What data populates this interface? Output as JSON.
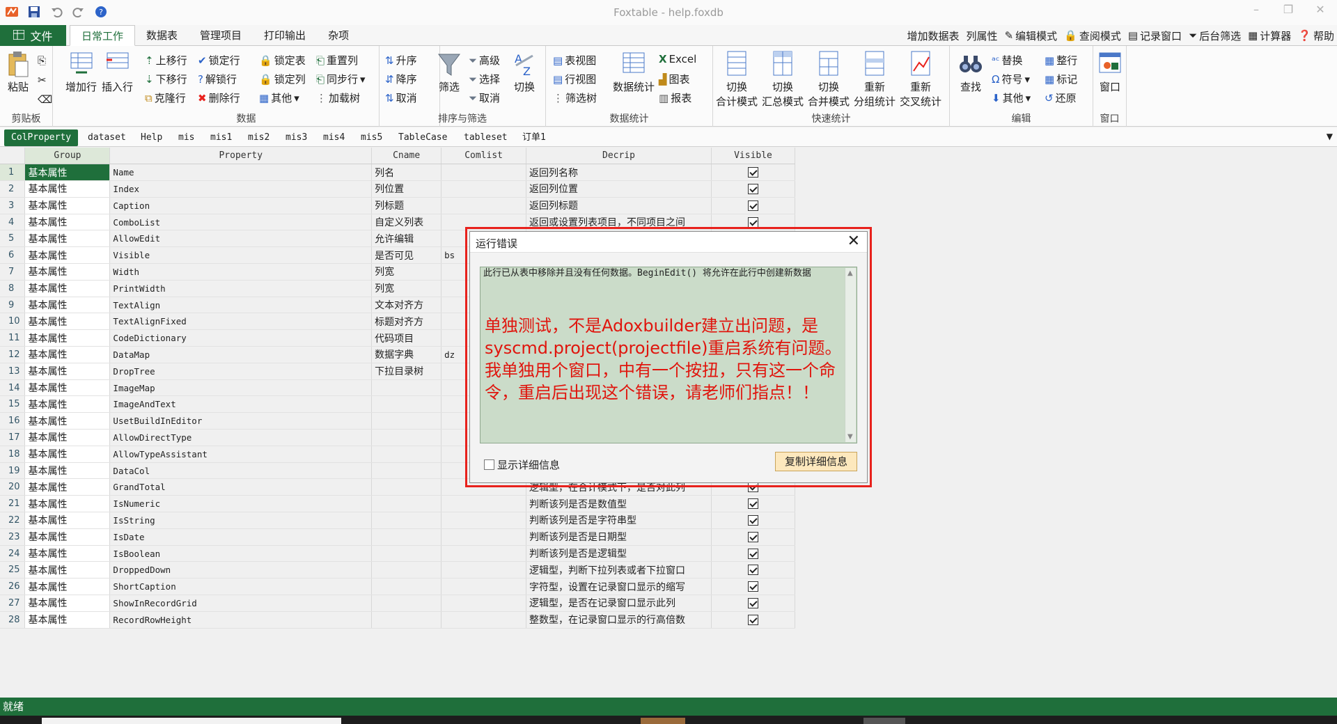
{
  "window": {
    "title": "Foxtable - help.foxdb"
  },
  "tabs": {
    "file": "文件",
    "items": [
      "日常工作",
      "数据表",
      "管理项目",
      "打印输出",
      "杂项"
    ]
  },
  "quick": {
    "add_table": "增加数据表",
    "col_props": "列属性",
    "edit_mode": "编辑模式",
    "view_mode": "查阅模式",
    "record_window": "记录窗口",
    "bg_filter": "后台筛选",
    "calculator": "计算器",
    "help": "帮助"
  },
  "ribbon": {
    "clipboard": {
      "label": "剪贴板",
      "paste": "粘贴"
    },
    "data": {
      "label": "数据",
      "add_row": "增加行",
      "insert_row": "插入行",
      "move_up": "上移行",
      "move_down": "下移行",
      "clone_row": "克隆行",
      "lock_row": "锁定行",
      "unlock_row": "解锁行",
      "delete_row": "删除行",
      "lock_table": "锁定表",
      "lock_col": "锁定列",
      "other": "其他",
      "reset_col": "重置列",
      "sync_row": "同步行",
      "load_tree": "加载树"
    },
    "sort": {
      "label": "排序与筛选",
      "asc": "升序",
      "desc": "降序",
      "cancel": "取消",
      "filter": "筛选",
      "advanced": "高级",
      "select": "选择",
      "cancel2": "取消",
      "switch": "切换"
    },
    "stats": {
      "label": "数据统计",
      "table_view": "表视图",
      "row_view": "行视图",
      "filter_tree": "筛选树",
      "data_stats": "数据统计",
      "excel": "Excel",
      "chart": "图表",
      "report": "报表"
    },
    "quickstats": {
      "label": "快速统计",
      "b1": [
        "切换",
        "合计模式"
      ],
      "b2": [
        "切换",
        "汇总模式"
      ],
      "b3": [
        "切换",
        "合并模式"
      ],
      "b4": [
        "重新",
        "分组统计"
      ],
      "b5": [
        "重新",
        "交叉统计"
      ]
    },
    "edit": {
      "label": "编辑",
      "find": "查找",
      "replace": "替换",
      "symbol": "符号",
      "other": "其他",
      "whole_row": "整行",
      "mark": "标记",
      "restore": "还原"
    },
    "window": {
      "label": "窗口",
      "window": "窗口"
    }
  },
  "sheet_tabs": [
    "ColProperty",
    "dataset",
    "Help",
    "mis",
    "mis1",
    "mis2",
    "mis3",
    "mis4",
    "mis5",
    "TableCase",
    "tableset",
    "订单1"
  ],
  "grid": {
    "columns": [
      "Group",
      "Property",
      "Cname",
      "Comlist",
      "Decrip",
      "Visible"
    ],
    "rows": [
      {
        "n": "1",
        "g": "基本属性",
        "p": "Name",
        "c": "列名",
        "cl": "",
        "d": "返回列名称",
        "v": true
      },
      {
        "n": "2",
        "g": "基本属性",
        "p": "Index",
        "c": "列位置",
        "cl": "",
        "d": "返回列位置",
        "v": true
      },
      {
        "n": "3",
        "g": "基本属性",
        "p": "Caption",
        "c": "列标题",
        "cl": "",
        "d": "返回列标题",
        "v": true
      },
      {
        "n": "4",
        "g": "基本属性",
        "p": "ComboList",
        "c": "自定义列表",
        "cl": "",
        "d": "返回或设置列表项目，不同项目之间",
        "v": true
      },
      {
        "n": "5",
        "g": "基本属性",
        "p": "AllowEdit",
        "c": "允许编辑",
        "cl": "",
        "d": "",
        "v": false
      },
      {
        "n": "6",
        "g": "基本属性",
        "p": "Visible",
        "c": "是否可见",
        "cl": "bs",
        "d": "",
        "v": false
      },
      {
        "n": "7",
        "g": "基本属性",
        "p": "Width",
        "c": "列宽",
        "cl": "",
        "d": "",
        "v": false
      },
      {
        "n": "8",
        "g": "基本属性",
        "p": "PrintWidth",
        "c": "列宽",
        "cl": "",
        "d": "",
        "v": false
      },
      {
        "n": "9",
        "g": "基本属性",
        "p": "TextAlign",
        "c": "文本对齐方",
        "cl": "",
        "d": "",
        "v": false
      },
      {
        "n": "10",
        "g": "基本属性",
        "p": "TextAlignFixed",
        "c": "标题对齐方",
        "cl": "",
        "d": "",
        "v": false
      },
      {
        "n": "11",
        "g": "基本属性",
        "p": "CodeDictionary",
        "c": "代码项目",
        "cl": "",
        "d": "",
        "v": false
      },
      {
        "n": "12",
        "g": "基本属性",
        "p": "DataMap",
        "c": "数据字典",
        "cl": "dz",
        "d": "",
        "v": false
      },
      {
        "n": "13",
        "g": "基本属性",
        "p": "DropTree",
        "c": "下拉目录树",
        "cl": "",
        "d": "",
        "v": false
      },
      {
        "n": "14",
        "g": "基本属性",
        "p": "ImageMap",
        "c": "",
        "cl": "",
        "d": "",
        "v": false
      },
      {
        "n": "15",
        "g": "基本属性",
        "p": "ImageAndText",
        "c": "",
        "cl": "",
        "d": "",
        "v": false
      },
      {
        "n": "16",
        "g": "基本属性",
        "p": "UsetBuildInEditor",
        "c": "",
        "cl": "",
        "d": "",
        "v": false
      },
      {
        "n": "17",
        "g": "基本属性",
        "p": "AllowDirectType",
        "c": "",
        "cl": "",
        "d": "",
        "v": false
      },
      {
        "n": "18",
        "g": "基本属性",
        "p": "AllowTypeAssistant",
        "c": "",
        "cl": "",
        "d": "",
        "v": false
      },
      {
        "n": "19",
        "g": "基本属性",
        "p": "DataCol",
        "c": "",
        "cl": "",
        "d": "",
        "v": false
      },
      {
        "n": "20",
        "g": "基本属性",
        "p": "GrandTotal",
        "c": "",
        "cl": "",
        "d": "逻辑型，在合计模式下，是否对此列",
        "v": true
      },
      {
        "n": "21",
        "g": "基本属性",
        "p": "IsNumeric",
        "c": "",
        "cl": "",
        "d": "判断该列是否是数值型",
        "v": true
      },
      {
        "n": "22",
        "g": "基本属性",
        "p": "IsString",
        "c": "",
        "cl": "",
        "d": "判断该列是否是字符串型",
        "v": true
      },
      {
        "n": "23",
        "g": "基本属性",
        "p": "IsDate",
        "c": "",
        "cl": "",
        "d": "判断该列是否是日期型",
        "v": true
      },
      {
        "n": "24",
        "g": "基本属性",
        "p": "IsBoolean",
        "c": "",
        "cl": "",
        "d": "判断该列是否是逻辑型",
        "v": true
      },
      {
        "n": "25",
        "g": "基本属性",
        "p": "DroppedDown",
        "c": "",
        "cl": "",
        "d": "逻辑型，判断下拉列表或者下拉窗口",
        "v": true
      },
      {
        "n": "26",
        "g": "基本属性",
        "p": "ShortCaption",
        "c": "",
        "cl": "",
        "d": "字符型，设置在记录窗口显示的缩写",
        "v": true
      },
      {
        "n": "27",
        "g": "基本属性",
        "p": "ShowInRecordGrid",
        "c": "",
        "cl": "",
        "d": "逻辑型，是否在记录窗口显示此列",
        "v": true
      },
      {
        "n": "28",
        "g": "基本属性",
        "p": "RecordRowHeight",
        "c": "",
        "cl": "",
        "d": "整数型，在记录窗口显示的行高倍数",
        "v": true
      }
    ]
  },
  "dialog": {
    "title": "运行错误",
    "system_message": "此行已从表中移除并且没有任何数据。BeginEdit() 将允许在此行中创建新数据",
    "note": "单独测试，不是Adoxbuilder建立出问题，是syscmd.project(projectfile)重启系统有问题。我单独用个窗口，中有一个按扭，只有这一个命令，重启后出现这个错误，请老师们指点！！",
    "show_details": "显示详细信息",
    "copy_details": "复制详细信息"
  },
  "status": {
    "text": "就绪"
  }
}
